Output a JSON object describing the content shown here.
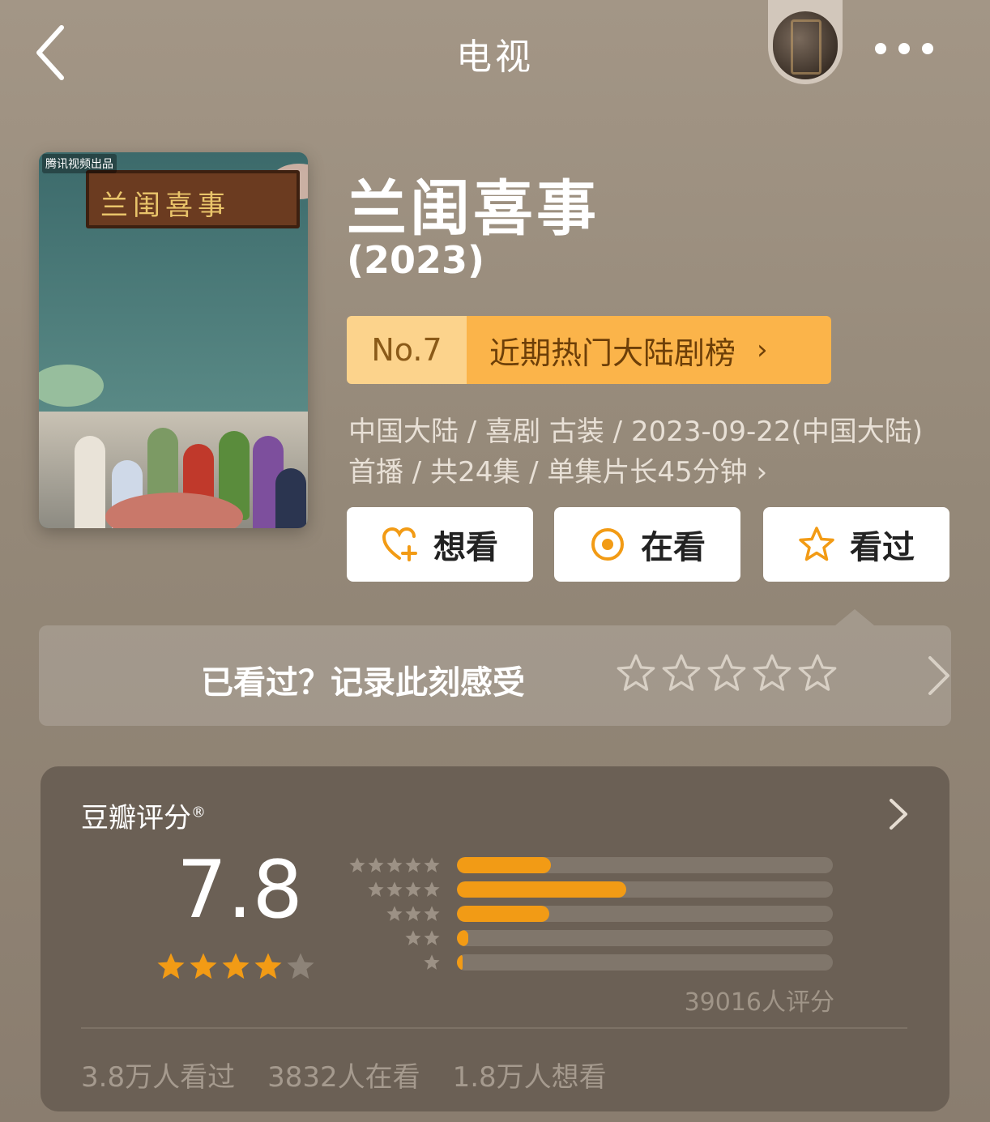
{
  "header": {
    "title": "电视",
    "back_icon": "chevron-left-icon",
    "more_icon": "more-dots-icon"
  },
  "poster": {
    "brand": "腾讯视频出品",
    "sign_text": "兰闺喜事"
  },
  "show": {
    "name": "兰闺喜事",
    "year": "(2023)",
    "rank_no": "No.7",
    "rank_label": "近期热门大陆剧榜",
    "meta_line1": "中国大陆 / 喜剧 古装 / 2023-09-22(中国大陆)",
    "meta_line2": "首播 / 共24集 / 单集片长45分钟"
  },
  "actions": {
    "want": "想看",
    "watching": "在看",
    "watched": "看过"
  },
  "feel": {
    "text": "已看过？记录此刻感受"
  },
  "rating": {
    "label": "豆瓣评分",
    "score": "7.8",
    "stars": 4,
    "distribution": [
      0.25,
      0.45,
      0.245,
      0.03,
      0.015
    ],
    "count_text": "39016人评分",
    "stats": [
      "3.8万人看过",
      "3832人在看",
      "1.8万人想看"
    ]
  },
  "colors": {
    "accent": "#f29b15",
    "rank_no_bg": "#fcd38c",
    "rank_label_bg": "#fbb44a",
    "card_bg": "#6b6055"
  }
}
